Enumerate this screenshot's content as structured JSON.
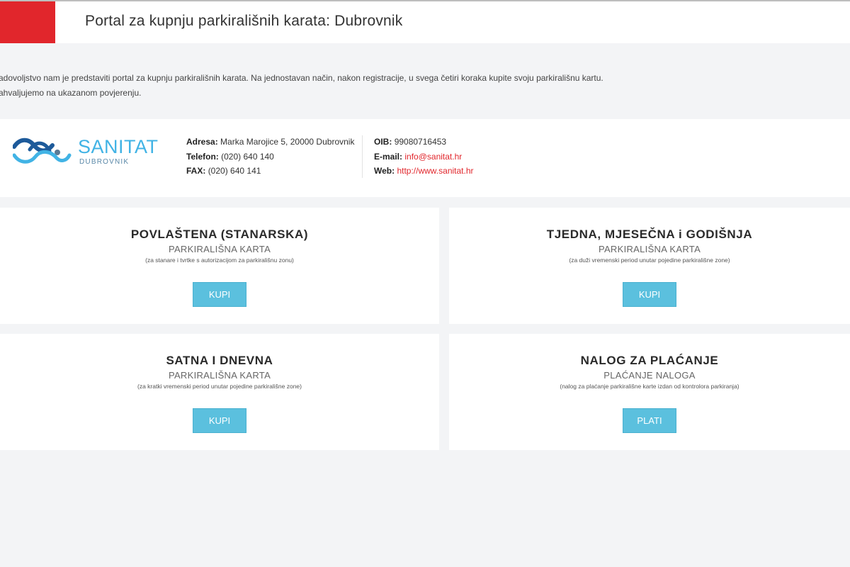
{
  "header": {
    "title": "Portal za kupnju parkirališnih karata: Dubrovnik"
  },
  "intro": {
    "line1": "adovoljstvo nam je predstaviti portal za kupnju parkirališnih karata. Na jednostavan način, nakon registracije, u svega četiri koraka kupite svoju parkirališnu kartu.",
    "line2": "ahvaljujemo na ukazanom povjerenju."
  },
  "company": {
    "brand": "SANITAT",
    "brand_sub": "DUBROVNIK",
    "address_label": "Adresa:",
    "address": "Marka Marojice 5, 20000 Dubrovnik",
    "phone_label": "Telefon:",
    "phone": "(020) 640 140",
    "fax_label": "FAX:",
    "fax": "(020) 640 141",
    "oib_label": "OIB:",
    "oib": "99080716453",
    "email_label": "E-mail:",
    "email": "info@sanitat.hr",
    "web_label": "Web:",
    "web": "http://www.sanitat.hr",
    "brand_color": "#41b3e5",
    "link_color": "#e1262c"
  },
  "cards": [
    {
      "title": "POVLAŠTENA (STANARSKA)",
      "subtitle": "PARKIRALIŠNA KARTA",
      "note": "(za stanare i tvrtke s autorizacijom za parkirališnu zonu)",
      "button": "KUPI"
    },
    {
      "title": "TJEDNA, MJESEČNA i GODIŠNJA",
      "subtitle": "PARKIRALIŠNA KARTA",
      "note": "(za duži vremenski period unutar pojedine parkirališne zone)",
      "button": "KUPI"
    },
    {
      "title": "SATNA I DNEVNA",
      "subtitle": "PARKIRALIŠNA KARTA",
      "note": "(za kratki vremenski period unutar pojedine parkirališne zone)",
      "button": "KUPI"
    },
    {
      "title": "NALOG ZA PLAĆANJE",
      "subtitle": "PLAĆANJE NALOGA",
      "note": "(nalog za plaćanje parkirališne karte izdan od kontrolora parkiranja)",
      "button": "PLATI"
    }
  ],
  "colors": {
    "accent_red": "#e1262c",
    "button_blue": "#5bc0de",
    "background": "#f3f4f6"
  }
}
